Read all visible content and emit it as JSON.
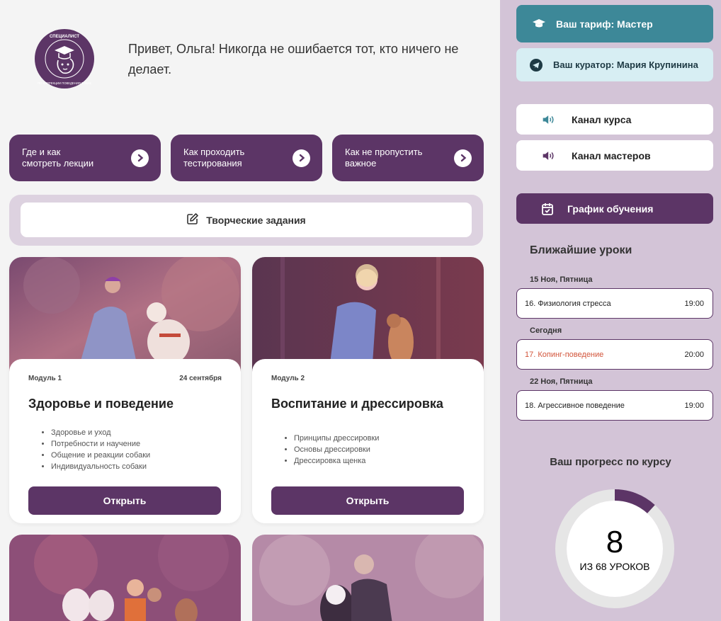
{
  "greeting": "Привет, Ольга! Никогда не ошибается тот, кто ничего не делает.",
  "logo": {
    "top_text": "СПЕЦИАЛИСТ",
    "bottom_text": "ПО КОРРЕКЦИИ ПОВЕДЕНИЯ СОБАК"
  },
  "info_buttons": [
    {
      "label": "Где и как\nсмотреть лекции"
    },
    {
      "label": "Как проходить\nтестирования"
    },
    {
      "label": "Как не пропустить\nважное"
    }
  ],
  "creative": {
    "label": "Творческие задания"
  },
  "modules": [
    {
      "module": "Модуль 1",
      "date": "24 сентября",
      "title": "Здоровье и поведение",
      "items": [
        "Здоровье и уход",
        "Потребности и научение",
        "Общение и реакции собаки",
        "Индивидуальность собаки"
      ],
      "button": "Открыть"
    },
    {
      "module": "Модуль 2",
      "date": "",
      "title": "Воспитание и дрессировка",
      "items": [
        "Принципы дрессировки",
        "Основы дрессировки",
        "Дрессировка щенка"
      ],
      "button": "Открыть"
    }
  ],
  "sidebar": {
    "tariff": "Ваш тариф: Мастер",
    "curator": "Ваш куратор: Мария Крупинина",
    "channel_course": "Канал курса",
    "channel_masters": "Канал мастеров",
    "schedule": "График обучения",
    "lessons_title": "Ближайшие уроки",
    "days": [
      {
        "label": "15 Ноя, Пятница",
        "lesson": "16. Физиология стресса",
        "time": "19:00"
      },
      {
        "label": "Сегодня",
        "lesson": "17. Копинг-поведение",
        "time": "20:00"
      },
      {
        "label": "22 Ноя, Пятница",
        "lesson": "18. Агрессивное поведение",
        "time": "19:00"
      }
    ],
    "progress_title": "Ваш прогресс по курсу",
    "progress_value": "8",
    "progress_sub": "ИЗ 68 УРОКОВ",
    "progress_fraction": 0.118
  },
  "colors": {
    "purple": "#5c3566",
    "teal": "#3d8898",
    "light_teal": "#d7eef3",
    "sidebar_bg": "#d3c4d7",
    "today_red": "#d2543a"
  }
}
